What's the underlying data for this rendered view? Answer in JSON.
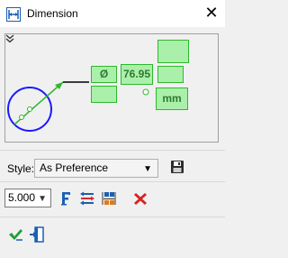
{
  "window": {
    "title": "Dimension",
    "close_glyph": "✕",
    "icon": "dimension-icon"
  },
  "preview": {
    "prefix": "Ø",
    "value": "76.95",
    "unit": "mm",
    "line_color": "#000000",
    "circle_color": "#1a1aff",
    "accent_color": "#2eb82e",
    "box_fill": "#aaf0aa",
    "collapse_icon": "double-chevron-down-icon"
  },
  "style": {
    "label": "Style:",
    "selected": "As Preference",
    "save_icon": "floppy-disk-icon"
  },
  "format": {
    "precision": "5.000",
    "icons": [
      "font-icon",
      "tolerance-icon",
      "dual-dimension-icon",
      "delete-icon"
    ]
  },
  "actions": {
    "icons": [
      "ok-check-icon",
      "exit-icon"
    ]
  }
}
